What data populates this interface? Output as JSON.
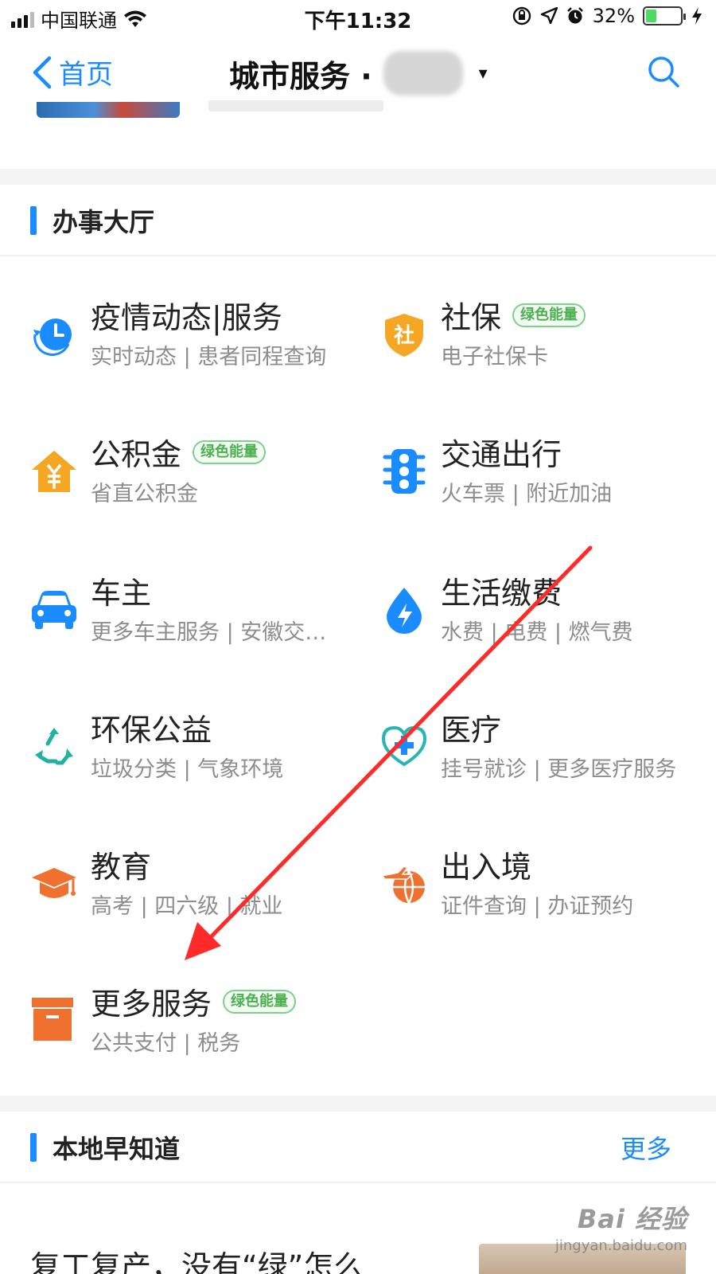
{
  "status_bar": {
    "carrier": "中国联通",
    "time": "下午11:32",
    "battery_percent": "32%",
    "battery_level": 0.32,
    "icons": [
      "signal-icon",
      "wifi-icon",
      "orientation-lock-icon",
      "location-icon",
      "alarm-icon",
      "battery-icon",
      "charging-icon"
    ]
  },
  "nav": {
    "back_label": "首页",
    "title": "城市服务 ·",
    "title_caret": "▾"
  },
  "sections": {
    "hall": {
      "title": "办事大厅"
    },
    "local_news": {
      "title": "本地早知道",
      "more_label": "更多"
    }
  },
  "services": [
    {
      "name": "疫情动态|服务",
      "sub": "实时动态 | 患者同程查询",
      "badge": "",
      "icon": "clock-refresh-icon",
      "color": "#1a8cff"
    },
    {
      "name": "社保",
      "sub": "电子社保卡",
      "badge": "绿色能量",
      "icon": "shield-she-icon",
      "color": "#f5a623"
    },
    {
      "name": "公积金",
      "sub": "省直公积金",
      "badge": "绿色能量",
      "icon": "house-yen-icon",
      "color": "#f5a623"
    },
    {
      "name": "交通出行",
      "sub": "火车票 | 附近加油",
      "badge": "",
      "icon": "traffic-light-icon",
      "color": "#1a8cff"
    },
    {
      "name": "车主",
      "sub": "更多车主服务 | 安徽交…",
      "badge": "",
      "icon": "car-icon",
      "color": "#1a8cff"
    },
    {
      "name": "生活缴费",
      "sub": "水费 | 电费 | 燃气费",
      "badge": "",
      "icon": "water-drop-bolt-icon",
      "color": "#1a8cff"
    },
    {
      "name": "环保公益",
      "sub": "垃圾分类 | 气象环境",
      "badge": "",
      "icon": "recycle-icon",
      "color": "#20b2a0"
    },
    {
      "name": "医疗",
      "sub": "挂号就诊 | 更多医疗服务",
      "badge": "",
      "icon": "stethoscope-icon",
      "color": "#2ab5b5"
    },
    {
      "name": "教育",
      "sub": "高考 | 四六级 | 就业",
      "badge": "",
      "icon": "graduation-cap-icon",
      "color": "#f07030"
    },
    {
      "name": "出入境",
      "sub": "证件查询 | 办证预约",
      "badge": "",
      "icon": "plane-globe-icon",
      "color": "#f07030"
    },
    {
      "name": "更多服务",
      "sub": "公共支付 | 税务",
      "badge": "绿色能量",
      "icon": "box-icon",
      "color": "#f07030"
    }
  ],
  "article": {
    "title": "复工复产，没有“绿”怎么"
  },
  "watermark": {
    "logo": "Bai 经验",
    "url": "jingyan.baidu.com"
  },
  "colors": {
    "accent": "#1a8cff",
    "badge_green": "#4cb050",
    "annotation_red": "#ff2a2a"
  }
}
